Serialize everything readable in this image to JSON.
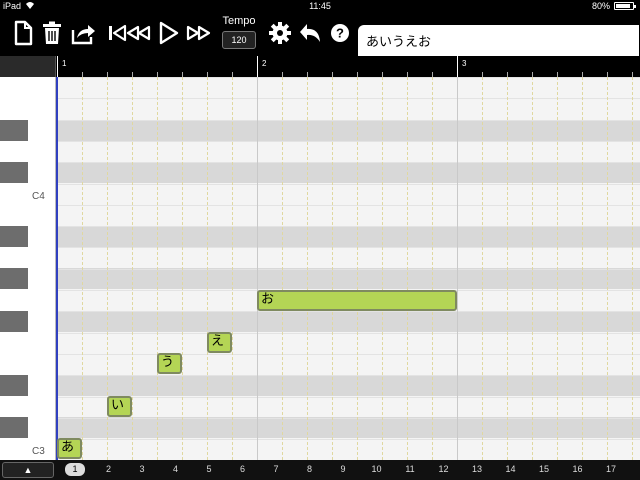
{
  "status": {
    "device": "iPad",
    "time": "11:45",
    "battery": "80%"
  },
  "toolbar": {
    "icons": [
      "new-file-icon",
      "trash-icon",
      "share-icon",
      "skip-back-icon",
      "rewind-icon",
      "play-icon",
      "fast-forward-icon",
      "gear-icon",
      "undo-icon",
      "help-icon"
    ],
    "tempo_label": "Tempo",
    "tempo_value": "120"
  },
  "lyrics": "あいうえお",
  "ruler": {
    "bars": [
      "1",
      "2",
      "3"
    ]
  },
  "keyboard": {
    "label_c4": "C4",
    "label_c3": "C3"
  },
  "notes": [
    {
      "lyric": "あ"
    },
    {
      "lyric": "い"
    },
    {
      "lyric": "う"
    },
    {
      "lyric": "え"
    },
    {
      "lyric": "お"
    }
  ],
  "bottom": {
    "up_label": "▲",
    "pages": [
      "1",
      "2",
      "3",
      "4",
      "5",
      "6",
      "7",
      "8",
      "9",
      "10",
      "11",
      "12",
      "13",
      "14",
      "15",
      "16",
      "17"
    ],
    "active_page": "1"
  },
  "colors": {
    "note_fill": "#b4d555",
    "playhead": "#3040c0"
  }
}
